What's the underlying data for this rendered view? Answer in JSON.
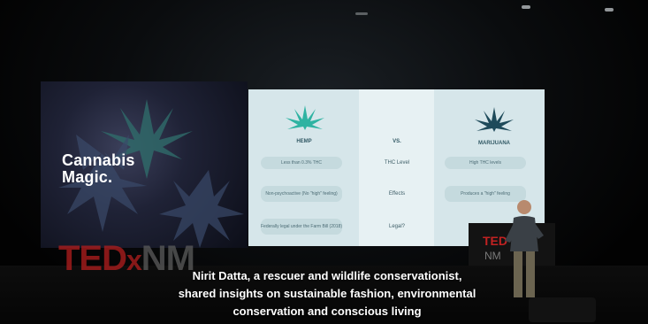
{
  "scene": {
    "left_screen_title_line1": "Cannabis",
    "left_screen_title_line2": "Magic.",
    "icons": [
      "cannabis-leaf-icon",
      "cannabis-leaf-icon"
    ]
  },
  "slide": {
    "col_left": "HEMP",
    "col_mid": "VS.",
    "col_right": "MARIJUANA",
    "rows": [
      {
        "left": "Less than 0.3% THC",
        "mid": "THC Level",
        "right": "High THC levels"
      },
      {
        "left": "Non-psychoactive (No \"high\" feeling)",
        "mid": "Effects",
        "right": "Produces a \"high\" feeling"
      },
      {
        "left": "Federally legal under the Farm Bill (2018)",
        "mid": "Legal?",
        "right": ""
      }
    ]
  },
  "branding": {
    "ted": "TED",
    "x": "x",
    "nm": "NM",
    "mini_ted": "TED",
    "mini_nm": "NM"
  },
  "caption": {
    "line1": "Nirit Datta, a rescuer and wildlife conservationist,",
    "line2": "shared insights on sustainable fashion, environmental",
    "line3": "conservation and conscious living"
  }
}
